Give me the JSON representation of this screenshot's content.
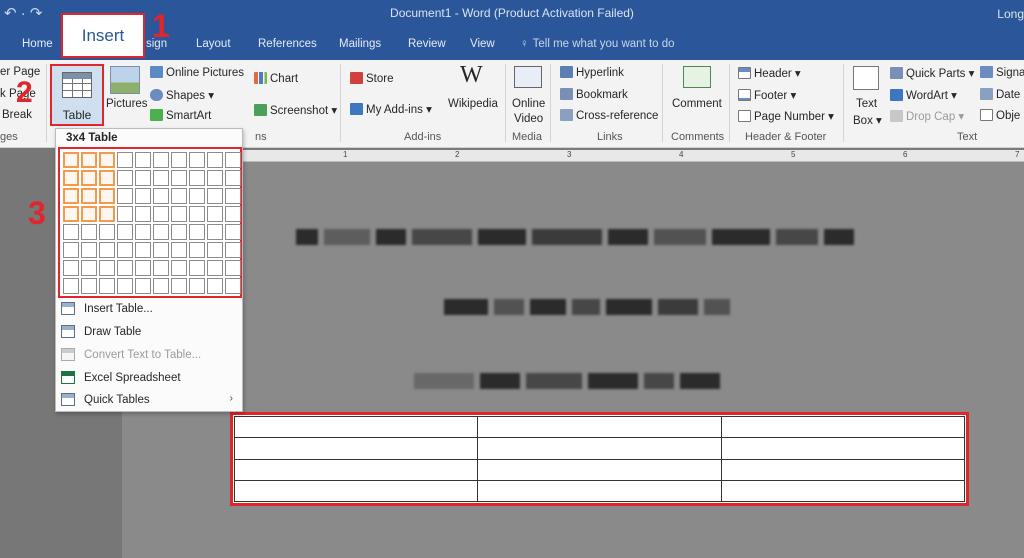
{
  "window": {
    "title": "Document1 - Word (Product Activation Failed)",
    "user": "Long",
    "quick_access": "↶ · ↷"
  },
  "tabs": [
    {
      "label": "Home"
    },
    {
      "label": "Insert"
    },
    {
      "label": "sign"
    },
    {
      "label": "Layout"
    },
    {
      "label": "References"
    },
    {
      "label": "Mailings"
    },
    {
      "label": "Review"
    },
    {
      "label": "View"
    }
  ],
  "tell_me": "Tell me what you want to do",
  "callouts": [
    "1",
    "2",
    "3"
  ],
  "ribbon": {
    "pages": {
      "items": [
        "er Page",
        "k Page",
        "Break"
      ],
      "group": "ges"
    },
    "table": {
      "label": "Table"
    },
    "illustrations": {
      "pictures": "Pictures",
      "online_pictures": "Online Pictures",
      "shapes": "Shapes",
      "smartart": "SmartArt",
      "chart": "Chart",
      "screenshot": "Screenshot",
      "group": "ns"
    },
    "addins": {
      "store": "Store",
      "my_addins": "My Add-ins",
      "wikipedia": "Wikipedia",
      "group": "Add-ins"
    },
    "media": {
      "online_video_1": "Online",
      "online_video_2": "Video",
      "group": "Media"
    },
    "links": {
      "hyperlink": "Hyperlink",
      "bookmark": "Bookmark",
      "cross_reference": "Cross-reference",
      "group": "Links"
    },
    "comments": {
      "comment": "Comment",
      "group": "Comments"
    },
    "header_footer": {
      "header": "Header",
      "footer": "Footer",
      "page_number": "Page Number",
      "group": "Header & Footer"
    },
    "text": {
      "text_box_1": "Text",
      "text_box_2": "Box",
      "quick_parts": "Quick Parts",
      "wordart": "WordArt",
      "drop_cap": "Drop Cap",
      "signature": "Signa",
      "date": "Date",
      "object": "Obje",
      "group": "Text"
    }
  },
  "ruler_numbers": [
    "1",
    "2",
    "3",
    "4",
    "5",
    "6",
    "7"
  ],
  "table_menu": {
    "grid_label": "3x4 Table",
    "grid_cols": 10,
    "grid_rows": 8,
    "selected_cols": 3,
    "selected_rows": 4,
    "items": [
      {
        "label": "Insert Table...",
        "enabled": true
      },
      {
        "label": "Draw Table",
        "enabled": true
      },
      {
        "label": "Convert Text to Table...",
        "enabled": false
      },
      {
        "label": "Excel Spreadsheet",
        "enabled": true
      },
      {
        "label": "Quick Tables",
        "enabled": true
      }
    ]
  },
  "document_table": {
    "rows": 4,
    "cols": 3
  },
  "colors": {
    "accent": "#2b579a",
    "highlight": "#e0252c",
    "selection": "#f39a4d"
  }
}
